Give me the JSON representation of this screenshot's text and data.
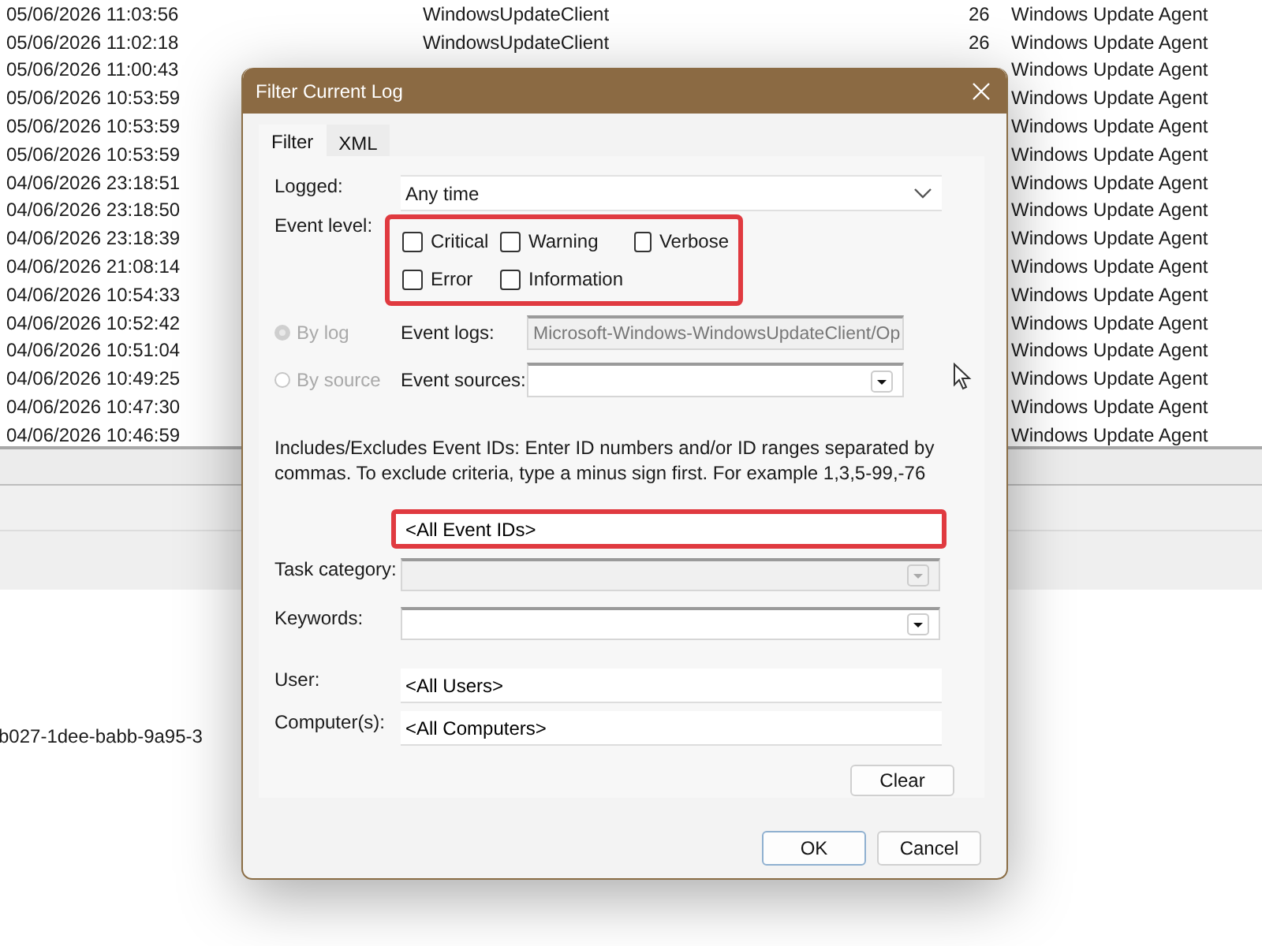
{
  "background": {
    "rows": [
      {
        "date": "05/06/2026 11:03:56",
        "source": "WindowsUpdateClient",
        "event_id": "26",
        "task_category": "Windows Update Agent"
      },
      {
        "date": "05/06/2026 11:02:18",
        "source": "WindowsUpdateClient",
        "event_id": "26",
        "task_category": "Windows Update Agent"
      },
      {
        "date": "05/06/2026 11:00:43",
        "task_category": "Windows Update Agent"
      },
      {
        "date": "05/06/2026 10:53:59",
        "task_category": "Windows Update Agent"
      },
      {
        "date": "05/06/2026 10:53:59",
        "task_category": "Windows Update Agent"
      },
      {
        "date": "05/06/2026 10:53:59",
        "task_category": "Windows Update Agent"
      },
      {
        "date": "04/06/2026 23:18:51",
        "task_category": "Windows Update Agent"
      },
      {
        "date": "04/06/2026 23:18:50",
        "task_category": "Windows Update Agent"
      },
      {
        "date": "04/06/2026 23:18:39",
        "task_category": "Windows Update Agent"
      },
      {
        "date": "04/06/2026 21:08:14",
        "task_category": "Windows Update Agent"
      },
      {
        "date": "04/06/2026 10:54:33",
        "task_category": "Windows Update Agent"
      },
      {
        "date": "04/06/2026 10:52:42",
        "task_category": "Windows Update Agent"
      },
      {
        "date": "04/06/2026 10:51:04",
        "task_category": "Windows Update Agent"
      },
      {
        "date": "04/06/2026 10:49:25",
        "task_category": "Windows Update Agent"
      },
      {
        "date": "04/06/2026 10:47:30",
        "task_category": "Windows Update Agent"
      },
      {
        "date": "04/06/2026 10:46:59",
        "task_category": "Windows Update Agent"
      }
    ],
    "details_text": "b027-1dee-babb-9a95-3"
  },
  "dialog": {
    "title": "Filter Current Log",
    "tabs": [
      {
        "label": "Filter",
        "selected": true
      },
      {
        "label": "XML",
        "selected": false
      }
    ],
    "logged": {
      "label": "Logged:",
      "value": "Any time"
    },
    "event_level": {
      "label": "Event level:",
      "highlighted": true,
      "options": [
        {
          "label": "Critical",
          "checked": false
        },
        {
          "label": "Warning",
          "checked": false
        },
        {
          "label": "Verbose",
          "checked": false
        },
        {
          "label": "Error",
          "checked": false
        },
        {
          "label": "Information",
          "checked": false
        }
      ]
    },
    "scope": [
      {
        "label": "By log",
        "selected": true,
        "disabled": true,
        "field_label": "Event logs:",
        "field_value": "Microsoft-Windows-WindowsUpdateClient/Op",
        "field_disabled": true
      },
      {
        "label": "By source",
        "selected": false,
        "disabled": true,
        "field_label": "Event sources:",
        "field_disabled": false
      }
    ],
    "description": "Includes/Excludes Event IDs: Enter ID numbers and/or ID ranges separated by commas. To exclude criteria, type a minus sign first. For example 1,3,5-99,-76",
    "event_ids": {
      "value": "<All Event IDs>",
      "highlighted": true
    },
    "task_category": {
      "label": "Task category:",
      "disabled": true
    },
    "keywords": {
      "label": "Keywords:",
      "disabled": false
    },
    "user": {
      "label": "User:",
      "value": "<All Users>"
    },
    "computers": {
      "label": "Computer(s):",
      "value": "<All Computers>"
    },
    "clear_button": "Clear",
    "buttons": [
      {
        "label": "OK",
        "default": true
      },
      {
        "label": "Cancel",
        "default": false
      }
    ]
  }
}
